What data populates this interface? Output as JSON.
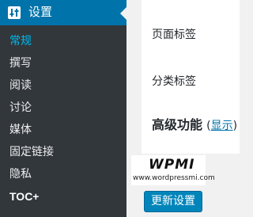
{
  "sidebar": {
    "header_label": "设置",
    "items": [
      {
        "label": "常规",
        "current": true
      },
      {
        "label": "撰写"
      },
      {
        "label": "阅读"
      },
      {
        "label": "讨论"
      },
      {
        "label": "媒体"
      },
      {
        "label": "固定链接"
      },
      {
        "label": "隐私"
      },
      {
        "label": "TOC+"
      }
    ]
  },
  "main": {
    "page_tag_label": "页面标签",
    "category_tag_label": "分类标签",
    "advanced_title": "高级功能",
    "advanced_toggle": "显示",
    "save_button": "更新设置"
  },
  "watermark": {
    "logo_text": "WPMI",
    "url": "www.wordpressmi.com"
  },
  "colors": {
    "sidebar_bg": "#23282d",
    "submenu_bg": "#32373c",
    "accent": "#0073aa",
    "current_item": "#00b9eb",
    "button": "#0085ba"
  },
  "icons": {
    "settings": "settings-sliders-icon"
  }
}
